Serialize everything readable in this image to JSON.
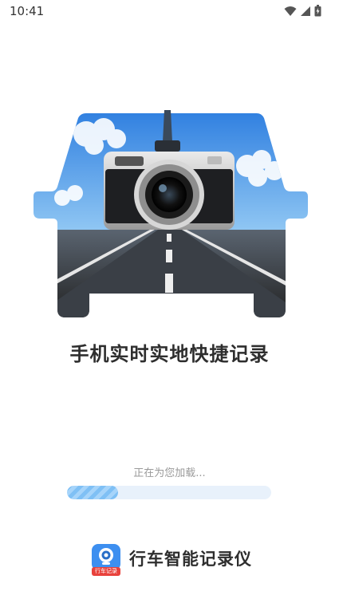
{
  "status_bar": {
    "time": "10:41",
    "icons": [
      "wifi-icon",
      "signal-icon",
      "battery-icon"
    ]
  },
  "hero": {
    "image": "car-silhouette-camera-road-illustration"
  },
  "slogan": "手机实时实地快捷记录",
  "loading": {
    "text": "正在为您加载...",
    "progress": 0.25
  },
  "app": {
    "name": "行车智能记录仪",
    "logo_tag": "行车记录",
    "logo": "dashcam-app-logo"
  },
  "colors": {
    "accent": "#3d8ff0",
    "progress_track": "#e8f1fb",
    "progress_fill": "#8cc8f7",
    "logo_tag": "#e8423c"
  }
}
